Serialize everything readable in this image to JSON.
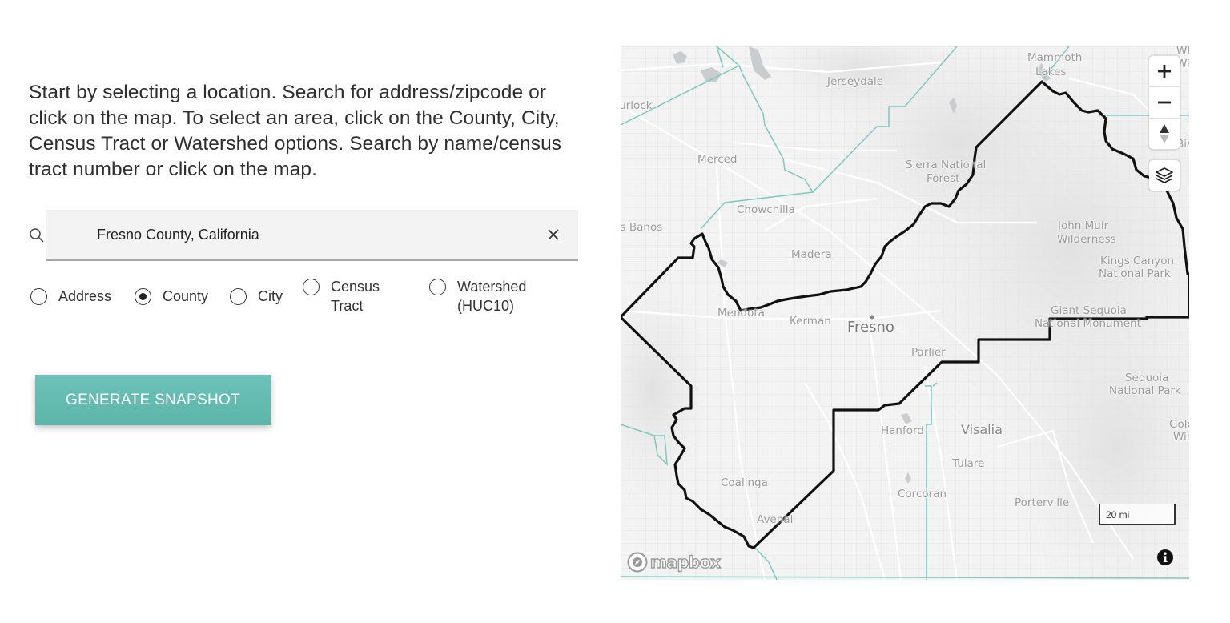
{
  "intro_text": "Start by selecting a location. Search for address/zipcode or click on the map. To select an area, click on the County, City, Census Tract or Watershed options. Search by name/census tract number or click on the map.",
  "search": {
    "value": "Fresno County, California",
    "placeholder": "",
    "search_icon": "search-icon",
    "clear_icon": "close-icon"
  },
  "selection_modes": {
    "selected": "County",
    "options": [
      {
        "label": "Address",
        "checked": false
      },
      {
        "label": "County",
        "checked": true
      },
      {
        "label": "City",
        "checked": false
      },
      {
        "label": "Census Tract",
        "checked": false
      },
      {
        "label": "Watershed (HUC10)",
        "checked": false
      }
    ]
  },
  "generate_button": "GENERATE SNAPSHOT",
  "colors": {
    "accent": "#62b9ae",
    "boundary": "#111111",
    "county_lines": "#7cc8be",
    "map_bg": "#f2f2f2"
  },
  "map": {
    "selected_area": "Fresno County",
    "controls": {
      "zoom_in": "+",
      "zoom_out": "−",
      "compass_icon": "compass-icon",
      "layers_icon": "layers-icon",
      "info_icon": "info-icon"
    },
    "scale_label": "20 mi",
    "attribution": "mapbox",
    "labels": {
      "mammoth": "Mammoth",
      "lakes": "Lakes",
      "jerseydale": "Jerseydale",
      "turlock": "Turlock",
      "merced": "Merced",
      "sierra1": "Sierra National",
      "sierra2": "Forest",
      "chowchilla": "Chowchilla",
      "losbanos": "Los Banos",
      "madera": "Madera",
      "johnmuir1": "John Muir",
      "johnmuir2": "Wilderness",
      "kings1": "Kings Canyon",
      "kings2": "National Park",
      "mendota": "Mendota",
      "kerman": "Kerman",
      "fresno": "Fresno",
      "giant1": "Giant Sequoia",
      "giant2": "National Monument",
      "parlier": "Parlier",
      "sequoia1": "Sequoia",
      "sequoia2": "National Park",
      "hanford": "Hanford",
      "visalia": "Visalia",
      "golden1": "Golden Trout",
      "golden2": "Wilderness",
      "tulare": "Tulare",
      "coalinga": "Coalinga",
      "corcoran": "Corcoran",
      "porterville": "Porterville",
      "avenal": "Avenal",
      "white1": "White Mountain",
      "white2": "Wilderness",
      "bishop": "Bishop"
    }
  }
}
